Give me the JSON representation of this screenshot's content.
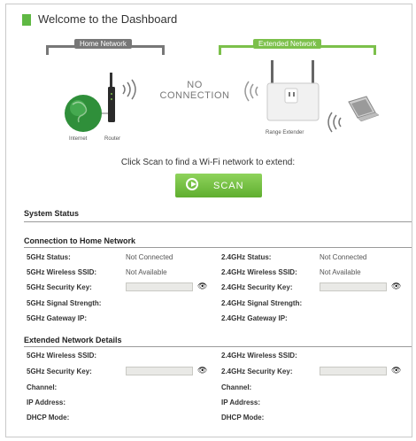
{
  "welcome": {
    "title": "Welcome to the Dashboard"
  },
  "diagram": {
    "home_tag": "Home Network",
    "ext_tag": "Extended Network",
    "no_connection_line1": "NO",
    "no_connection_line2": "CONNECTION",
    "internet_label": "Internet",
    "router_label": "Router",
    "extender_label": "Range Extender"
  },
  "scan": {
    "message": "Click Scan to find a Wi-Fi network to extend:",
    "button_label": "SCAN"
  },
  "system_status": {
    "title": "System Status"
  },
  "connection": {
    "title": "Connection to Home Network",
    "left": [
      {
        "label": "5GHz Status:",
        "value": "Not Connected"
      },
      {
        "label": "5GHz Wireless SSID:",
        "value": "Not Available"
      },
      {
        "label": "5GHz Security Key:",
        "value": ""
      },
      {
        "label": "5GHz Signal Strength:",
        "value": ""
      },
      {
        "label": "5GHz Gateway IP:",
        "value": ""
      }
    ],
    "right": [
      {
        "label": "2.4GHz Status:",
        "value": "Not Connected"
      },
      {
        "label": "2.4GHz Wireless SSID:",
        "value": "Not Available"
      },
      {
        "label": "2.4GHz Security Key:",
        "value": ""
      },
      {
        "label": "2.4GHz Signal Strength:",
        "value": ""
      },
      {
        "label": "2.4GHz Gateway IP:",
        "value": ""
      }
    ]
  },
  "extended": {
    "title": "Extended Network Details",
    "left": [
      {
        "label": "5GHz Wireless SSID:"
      },
      {
        "label": "5GHz Security Key:"
      },
      {
        "label": "Channel:"
      },
      {
        "label": "IP Address:"
      },
      {
        "label": "DHCP Mode:"
      }
    ],
    "right": [
      {
        "label": "2.4GHz Wireless SSID:"
      },
      {
        "label": "2.4GHz Security Key:"
      },
      {
        "label": "Channel:"
      },
      {
        "label": "IP Address:"
      },
      {
        "label": "DHCP Mode:"
      }
    ]
  },
  "icons": {
    "eye": "eye-icon",
    "play": "play-icon"
  },
  "colors": {
    "accent_green": "#5fb843",
    "home_gray": "#777777"
  }
}
